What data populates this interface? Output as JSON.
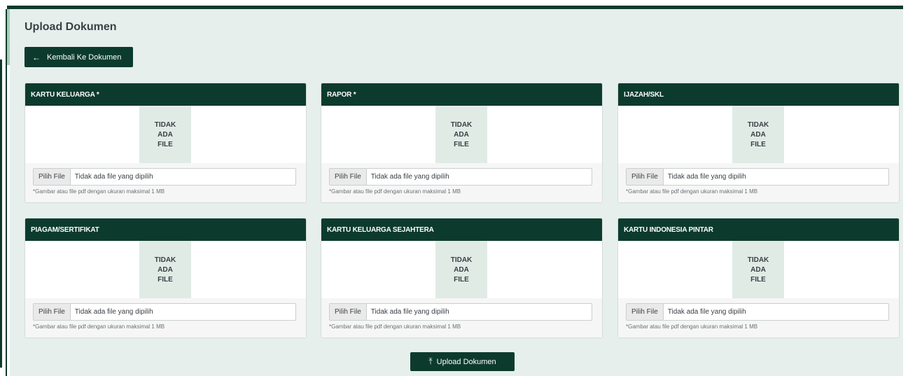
{
  "page": {
    "title": "Upload Dokumen",
    "back_button": "Kembali Ke Dokumen",
    "back_icon": "←",
    "upload_button": "Upload Dokumen",
    "upload_icon": "⤒"
  },
  "common": {
    "no_file_line1": "TIDAK",
    "no_file_line2": "ADA",
    "no_file_line3": "FILE",
    "choose_file": "Pilih File",
    "file_status": "Tidak ada file yang dipilih",
    "hint": "*Gambar atau file pdf dengan ukuran maksimal 1 MB"
  },
  "cards": [
    {
      "title": "KARTU KELUARGA *"
    },
    {
      "title": "RAPOR *"
    },
    {
      "title": "IJAZAH/SKL"
    },
    {
      "title": "PIAGAM/SERTIFIKAT"
    },
    {
      "title": "KARTU KELUARGA SEJAHTERA"
    },
    {
      "title": "KARTU INDONESIA PINTAR"
    }
  ],
  "colors": {
    "brand": "#0c3b2e",
    "panel": "#e6efeb",
    "no_file_bg": "#e0ebe6"
  }
}
